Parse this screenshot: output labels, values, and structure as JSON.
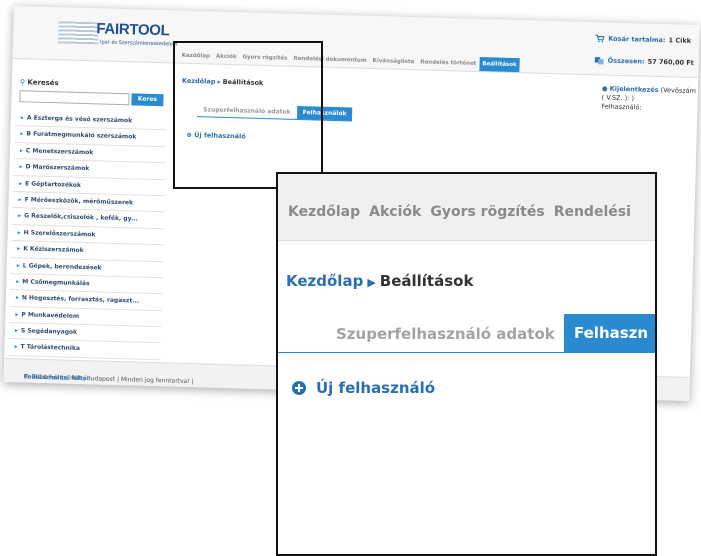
{
  "header": {
    "logo_name": "FAIRTOOL",
    "logo_tagline": "Ipar és Szerszámkereskedelem",
    "nav_tabs": [
      "Kezdőlap",
      "Akciók",
      "Gyors rögzítés",
      "Rendelési dokumentum",
      "Kívánságlista",
      "Rendelés történet",
      "Beállítások"
    ],
    "active_tab": "Beállítások",
    "cart_label": "Kosár tartalma:",
    "cart_value": "1 Cikk",
    "total_label": "Összesen:",
    "total_value": "57 760,00 Ft"
  },
  "sidebar": {
    "search_title": "Keresés",
    "search_value": "",
    "search_button": "Keres",
    "categories": [
      "A Esztergа és véső szerszámok",
      "B Furatmegmunkáló szerszámok",
      "C Menetszerszámok",
      "D Marószerszámok",
      "E Géptartozékok",
      "F Mérőeszközök, mérőműszerek",
      "G Reszelők,csiszolók , kefék, gy...",
      "H Szerelőszerszámok",
      "K Kéziszerszámok",
      "L Gépek, berendezések",
      "M Csőmegmunkálás",
      "N Hegesztés, forrasztás, ragaszt...",
      "P Munkavédelem",
      "S Segédanyagok",
      "T Tárolástechnika"
    ]
  },
  "main": {
    "breadcrumb_home": "Kezdőlap",
    "breadcrumb_current": "Beállítások",
    "subtabs": [
      "Szuperfelhasználó adatok",
      "Felhasználók"
    ],
    "new_user": "Új felhasználó"
  },
  "user_panel": {
    "logout": "Kijelentkezés",
    "line1": "(Vevőszám",
    "line2": "( V.SZ. ):            )",
    "line3": "Felhasználó:"
  },
  "footer": {
    "text": "© 2014 Fairtool Kft., Budapest | Minden jog fenntartva! |",
    "link": "Felhasználási felté"
  },
  "zoom": {
    "tabs": [
      "Kezdőlap",
      "Akciók",
      "Gyors rögzítés",
      "Rendelési"
    ],
    "breadcrumb_home": "Kezdőlap",
    "breadcrumb_current": "Beállítások",
    "subtab_inactive": "Szuperfelhasználó adatok",
    "subtab_active": "Felhaszn",
    "new_user": "Új felhasználó"
  },
  "colors": {
    "accent": "#2a8ad0",
    "link": "#2a6fb0",
    "border": "#111111"
  }
}
